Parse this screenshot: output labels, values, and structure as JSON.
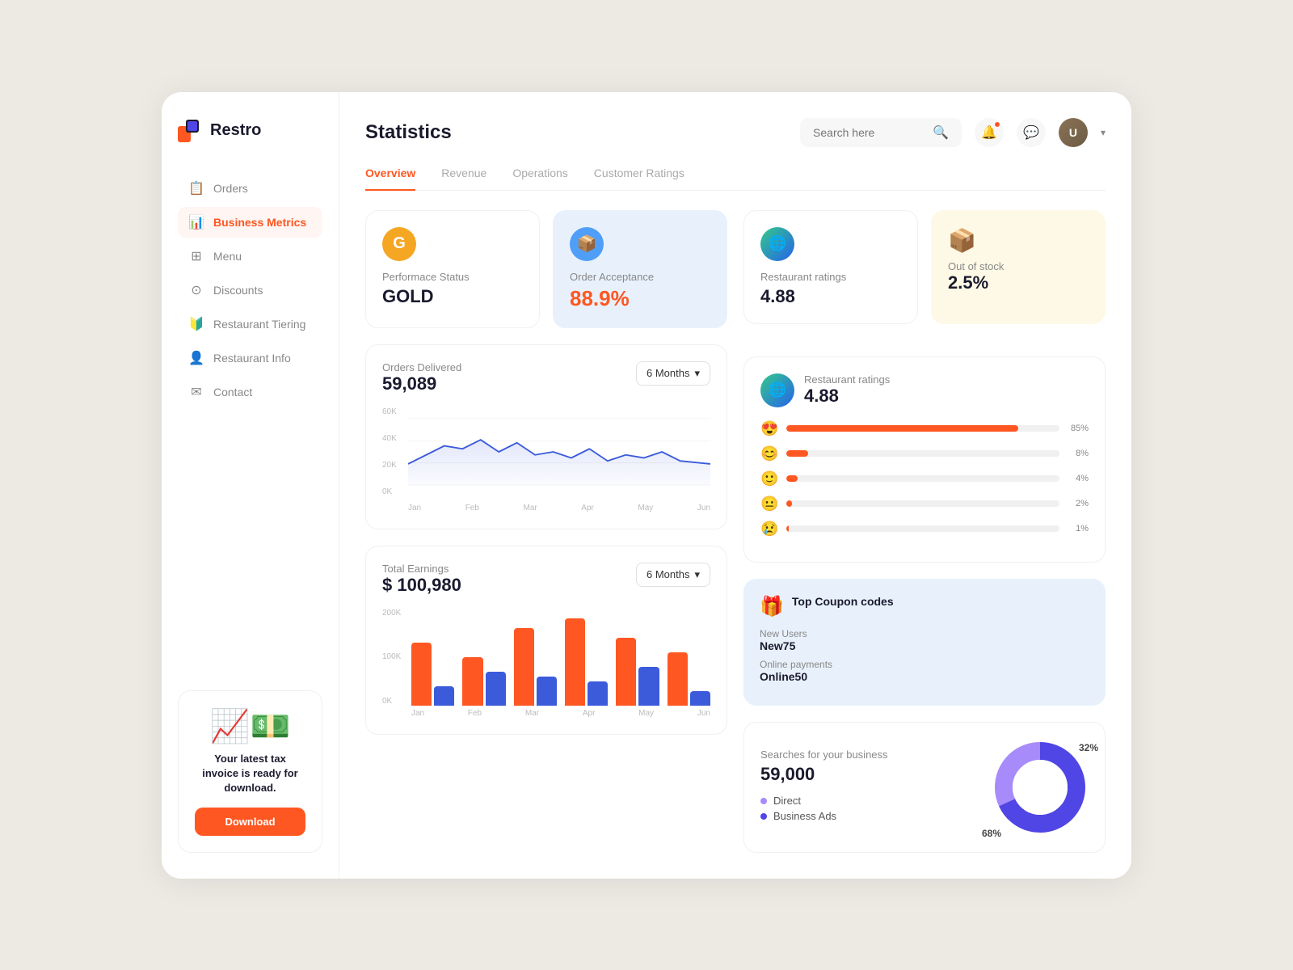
{
  "app": {
    "name": "Restro"
  },
  "sidebar": {
    "nav_items": [
      {
        "id": "orders",
        "label": "Orders",
        "icon": "📋",
        "active": false
      },
      {
        "id": "business-metrics",
        "label": "Business Metrics",
        "icon": "📊",
        "active": true
      },
      {
        "id": "menu",
        "label": "Menu",
        "icon": "⊞",
        "active": false
      },
      {
        "id": "discounts",
        "label": "Discounts",
        "icon": "⊙",
        "active": false
      },
      {
        "id": "restaurant-tiering",
        "label": "Restaurant Tiering",
        "icon": "🔰",
        "active": false
      },
      {
        "id": "restaurant-info",
        "label": "Restaurant Info",
        "icon": "👤",
        "active": false
      },
      {
        "id": "contact",
        "label": "Contact",
        "icon": "✉",
        "active": false
      }
    ],
    "tax_card": {
      "text": "Your latest tax invoice is ready for download.",
      "download_label": "Download"
    }
  },
  "header": {
    "title": "Statistics",
    "search_placeholder": "Search here"
  },
  "tabs": [
    {
      "id": "overview",
      "label": "Overview",
      "active": true
    },
    {
      "id": "revenue",
      "label": "Revenue",
      "active": false
    },
    {
      "id": "operations",
      "label": "Operations",
      "active": false
    },
    {
      "id": "customer-ratings",
      "label": "Customer Ratings",
      "active": false
    }
  ],
  "stats": {
    "performance": {
      "label": "Performace Status",
      "value": "GOLD"
    },
    "order_acceptance": {
      "label": "Order Acceptance",
      "value": "88.9%"
    },
    "restaurant_ratings": {
      "label": "Restaurant ratings",
      "value": "4.88"
    },
    "out_of_stock": {
      "label": "Out of stock",
      "value": "2.5%"
    }
  },
  "orders_chart": {
    "title": "Orders Delivered",
    "value": "59,089",
    "period": "6 Months",
    "y_labels": [
      "60K",
      "40K",
      "20K",
      "0K"
    ],
    "x_labels": [
      "Jan",
      "Feb",
      "Mar",
      "Apr",
      "May",
      "Jun"
    ]
  },
  "earnings_chart": {
    "title": "Total Earnings",
    "value": "$ 100,980",
    "period": "6 Months",
    "y_labels": [
      "200K",
      "100K",
      "0K"
    ],
    "x_labels": [
      "Jan",
      "Feb",
      "Mar",
      "Apr",
      "May",
      "Jun"
    ],
    "bars": [
      {
        "orange": 65,
        "blue": 20
      },
      {
        "orange": 50,
        "blue": 35
      },
      {
        "orange": 80,
        "blue": 30
      },
      {
        "orange": 90,
        "blue": 25
      },
      {
        "orange": 70,
        "blue": 40
      },
      {
        "orange": 55,
        "blue": 15
      }
    ]
  },
  "ratings": {
    "label": "Restaurant ratings",
    "value": "4.88",
    "bars": [
      {
        "emoji": "😍",
        "pct": 85,
        "label": "85%"
      },
      {
        "emoji": "😊",
        "pct": 8,
        "label": "8%"
      },
      {
        "emoji": "🙂",
        "pct": 4,
        "label": "4%"
      },
      {
        "emoji": "😐",
        "pct": 2,
        "label": "2%"
      },
      {
        "emoji": "😢",
        "pct": 1,
        "label": "1%"
      }
    ]
  },
  "coupons": {
    "title": "Top Coupon codes",
    "items": [
      {
        "label": "New Users",
        "code": "New75"
      },
      {
        "label": "Online payments",
        "code": "Online50"
      }
    ]
  },
  "searches": {
    "label": "Searches for your business",
    "value": "59,000",
    "legend": [
      {
        "label": "Direct",
        "color": "#a78bfa"
      },
      {
        "label": "Business Ads",
        "color": "#4f46e5"
      }
    ],
    "donut": {
      "pct1": "68%",
      "pct2": "32%"
    }
  },
  "colors": {
    "primary": "#ff5722",
    "accent_blue": "#4f46e5",
    "accent_purple": "#a78bfa",
    "gold": "#f5a623",
    "chart_line": "#3b5bdb"
  }
}
